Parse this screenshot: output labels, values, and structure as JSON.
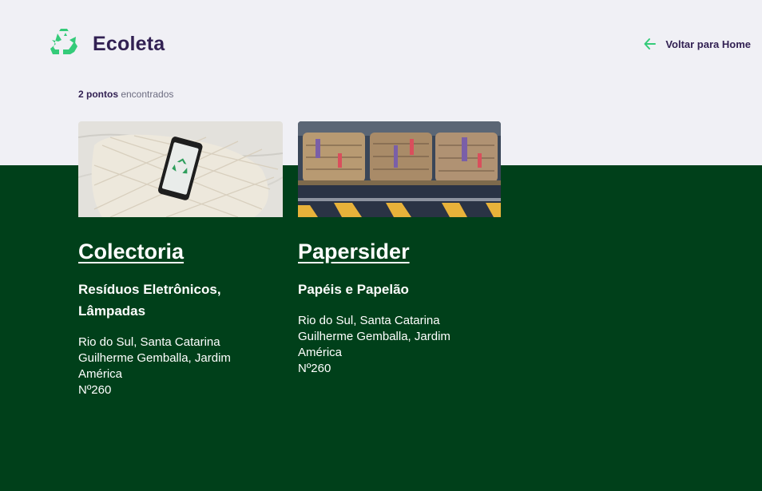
{
  "header": {
    "brand": "Ecoleta",
    "logo_icon": "recycle-icon",
    "back_label": "Voltar para Home",
    "back_icon": "arrow-left-icon"
  },
  "results": {
    "count_strong": "2 pontos",
    "count_rest": " encontrados"
  },
  "colors": {
    "background": "#F0F0F5",
    "band": "#00401A",
    "accent": "#34CB79",
    "heading": "#322153",
    "muted": "#6C6C80"
  },
  "points": [
    {
      "name": "Colectoria",
      "items": "Resíduos Eletrônicos, Lâmpadas",
      "city_uf": "Rio do Sul, Santa Catarina",
      "street": "Guilherme Gemballa, Jardim América",
      "number": "Nº260",
      "image": "phone-recycle-photo"
    },
    {
      "name": "Papersider",
      "items": "Papéis e Papelão",
      "city_uf": "Rio do Sul, Santa Catarina",
      "street": "Guilherme Gemballa, Jardim América",
      "number": "Nº260",
      "image": "cardboard-bales-photo"
    }
  ]
}
